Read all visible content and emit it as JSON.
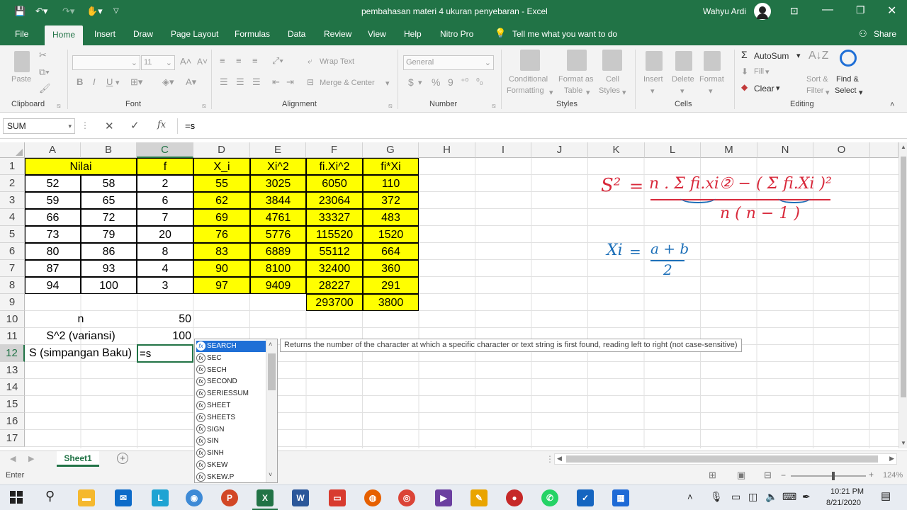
{
  "window": {
    "title": "pembahasan materi 4 ukuran penyebaran  -  Excel",
    "user": "Wahyu Ardi",
    "share_label": "Share"
  },
  "tabs": [
    "File",
    "Home",
    "Insert",
    "Draw",
    "Page Layout",
    "Formulas",
    "Data",
    "Review",
    "View",
    "Help",
    "Nitro Pro"
  ],
  "tell_me": "Tell me what you want to do",
  "ribbon": {
    "clipboard": {
      "paste": "Paste",
      "label": "Clipboard"
    },
    "font": {
      "name": "",
      "size": "11",
      "label": "Font",
      "bold": "B",
      "italic": "I",
      "underline": "U"
    },
    "alignment": {
      "wrap": "Wrap Text",
      "merge": "Merge & Center",
      "label": "Alignment"
    },
    "number": {
      "format": "General",
      "label": "Number",
      "currency": "$",
      "percent": "%",
      "comma": "9"
    },
    "styles": {
      "cond1": "Conditional",
      "cond2": "Formatting",
      "fmt1": "Format as",
      "fmt2": "Table",
      "cell1": "Cell",
      "cell2": "Styles",
      "label": "Styles"
    },
    "cells": {
      "insert": "Insert",
      "delete": "Delete",
      "format": "Format",
      "label": "Cells"
    },
    "editing": {
      "autosum": "AutoSum",
      "fill": "Fill",
      "clear": "Clear",
      "sort1": "Sort &",
      "sort2": "Filter",
      "find1": "Find &",
      "find2": "Select",
      "label": "Editing"
    }
  },
  "formula_bar": {
    "name_box": "SUM",
    "content": "=s",
    "fx": "fx"
  },
  "columns": [
    "A",
    "B",
    "C",
    "D",
    "E",
    "F",
    "G",
    "H",
    "I",
    "J",
    "K",
    "L",
    "M",
    "N",
    "O"
  ],
  "rows": [
    "1",
    "2",
    "3",
    "4",
    "5",
    "6",
    "7",
    "8",
    "9",
    "10",
    "11",
    "12",
    "13",
    "14",
    "15",
    "16",
    "17"
  ],
  "table": {
    "headers": {
      "nilai": "Nilai",
      "f": "f",
      "xi": "X_i",
      "xi2": "Xi^2",
      "fixi2": "fi.Xi^2",
      "fixi": "fi*Xi"
    },
    "a": [
      "52",
      "59",
      "66",
      "73",
      "80",
      "87",
      "94"
    ],
    "b": [
      "58",
      "65",
      "72",
      "79",
      "86",
      "93",
      "100"
    ],
    "c": [
      "2",
      "6",
      "7",
      "20",
      "8",
      "4",
      "3"
    ],
    "d": [
      "55",
      "62",
      "69",
      "76",
      "83",
      "90",
      "97"
    ],
    "e": [
      "3025",
      "3844",
      "4761",
      "5776",
      "6889",
      "8100",
      "9409"
    ],
    "f": [
      "6050",
      "23064",
      "33327",
      "115520",
      "55112",
      "32400",
      "28227"
    ],
    "g": [
      "110",
      "372",
      "483",
      "1520",
      "664",
      "360",
      "291"
    ],
    "f_total": "293700",
    "g_total": "3800",
    "n_label": "n",
    "n_value": "50",
    "var_label": "S^2 (variansi)",
    "var_value": "100",
    "sd_label": "S (simpangan Baku)",
    "sd_input": "=s"
  },
  "ink": {
    "s2": "S²",
    "eq": "=",
    "numerator": "n . Σ fi.xi② − ( Σ fi.Xi )²",
    "denominator": "n ( n − 1 )",
    "xi_lhs": "Xi",
    "xi_eq": "=",
    "xi_num": "a + b",
    "xi_den": "2"
  },
  "autocomplete": {
    "items": [
      "SEARCH",
      "SEC",
      "SECH",
      "SECOND",
      "SERIESSUM",
      "SHEET",
      "SHEETS",
      "SIGN",
      "SIN",
      "SINH",
      "SKEW",
      "SKEW.P"
    ],
    "tooltip": "Returns the number of the character at which a specific character or text string is first found, reading left to right (not case-sensitive)"
  },
  "sheet_tab": "Sheet1",
  "status": {
    "mode": "Enter",
    "zoom": "124%"
  },
  "taskbar": {
    "time": "10:21 PM",
    "date": "8/21/2020"
  },
  "colors": {
    "excel_green": "#217346",
    "highlight": "#ffff00",
    "ink_red": "#d8283a",
    "ink_blue": "#1c6fb8"
  }
}
